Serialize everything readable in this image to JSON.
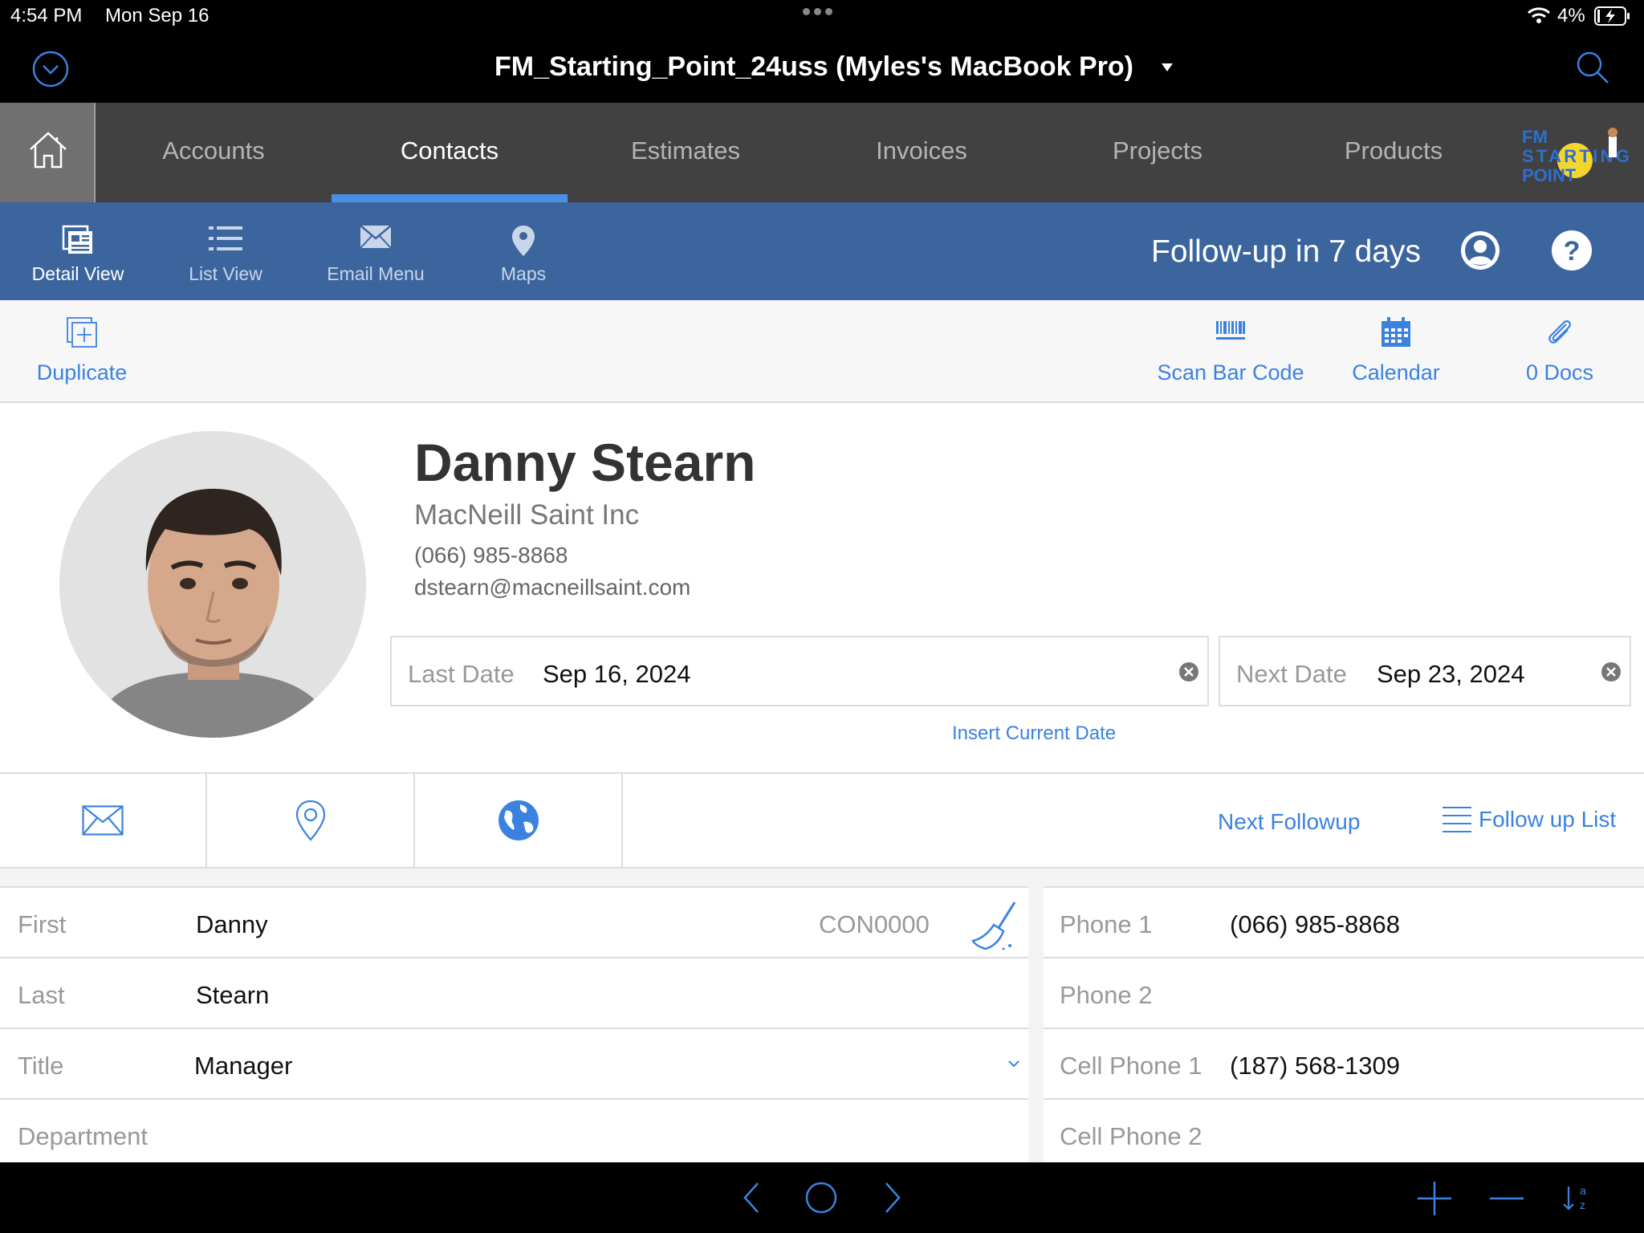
{
  "status_bar": {
    "time": "4:54 PM",
    "date": "Mon Sep 16",
    "battery": "4%"
  },
  "window": {
    "title": "FM_Starting_Point_24uss (Myles's MacBook Pro)"
  },
  "tabs": [
    {
      "label": "Accounts"
    },
    {
      "label": "Contacts",
      "active": true
    },
    {
      "label": "Estimates"
    },
    {
      "label": "Invoices"
    },
    {
      "label": "Projects"
    },
    {
      "label": "Products"
    }
  ],
  "logo": {
    "line1": "FM",
    "line2": "STARTING",
    "line3": "POINT"
  },
  "view_nav": [
    {
      "label": "Detail View",
      "icon": "detail-view-icon",
      "active": true
    },
    {
      "label": "List View",
      "icon": "list-view-icon"
    },
    {
      "label": "Email Menu",
      "icon": "envelope-icon"
    },
    {
      "label": "Maps",
      "icon": "map-pin-icon"
    }
  ],
  "followup_text": "Follow-up in 7 days",
  "toolbar": {
    "duplicate": "Duplicate",
    "scan": "Scan Bar Code",
    "calendar": "Calendar",
    "docs": "0 Docs"
  },
  "contact": {
    "name": "Danny Stearn",
    "company": "MacNeill Saint Inc",
    "phone": "(066) 985-8868",
    "email": "dstearn@macneillsaint.com"
  },
  "dates": {
    "last_label": "Last Date",
    "last_value": "Sep 16, 2024",
    "next_label": "Next Date",
    "next_value": "Sep 23, 2024",
    "insert_current": "Insert Current Date"
  },
  "actions": {
    "next_followup": "Next Followup",
    "followup_list": "Follow up List"
  },
  "form_left": {
    "first_label": "First",
    "first_value": "Danny",
    "record_id": "CON0000",
    "last_label": "Last",
    "last_value": "Stearn",
    "title_label": "Title",
    "title_value": "Manager",
    "department_label": "Department",
    "department_value": ""
  },
  "form_right": {
    "phone1_label": "Phone 1",
    "phone1_value": "(066) 985-8868",
    "phone2_label": "Phone 2",
    "phone2_value": "",
    "cell1_label": "Cell Phone 1",
    "cell1_value": "(187) 568-1309",
    "cell2_label": "Cell Phone 2",
    "cell2_value": ""
  },
  "colors": {
    "accent": "#3b82e0",
    "nav_blue": "#3c659e",
    "tab_bg": "#414141"
  }
}
